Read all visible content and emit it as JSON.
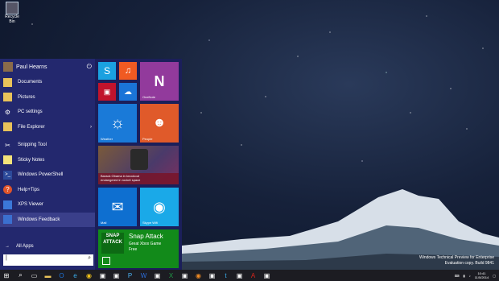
{
  "desktop": {
    "icon_label": "Recycle Bin",
    "watermark": [
      "Windows Technical Preview for Enterprise",
      "Evaluation copy. Build 9841"
    ]
  },
  "start_menu": {
    "user": "Paul Hearns",
    "items": [
      {
        "label": "Documents",
        "icon": "folder-icon"
      },
      {
        "label": "Pictures",
        "icon": "pictures-icon"
      },
      {
        "label": "PC settings",
        "icon": "gear-icon"
      },
      {
        "label": "File Explorer",
        "icon": "folder-icon"
      },
      {
        "label": "Snipping Tool",
        "icon": "scissors-icon"
      },
      {
        "label": "Sticky Notes",
        "icon": "note-icon"
      },
      {
        "label": "Windows PowerShell",
        "icon": "terminal-icon"
      },
      {
        "label": "Help+Tips",
        "icon": "help-icon"
      },
      {
        "label": "XPS Viewer",
        "icon": "doc-icon"
      },
      {
        "label": "Windows Feedback",
        "icon": "feedback-icon"
      }
    ],
    "all_apps": "All Apps",
    "search_placeholder": ""
  },
  "tiles": {
    "onenote": "OneNote",
    "weather": "Weather",
    "people": "People",
    "news_line1": "Barack Obama in knockout",
    "news_line2": "endangered in rocket space",
    "mail": "Mail",
    "skype": "Skype Wifi",
    "snap_title": "Snap Attack",
    "snap_sub": "Great Xbox Game",
    "snap_price": "Free"
  },
  "tray": {
    "time": "10:41",
    "date": "11/5/2014"
  }
}
